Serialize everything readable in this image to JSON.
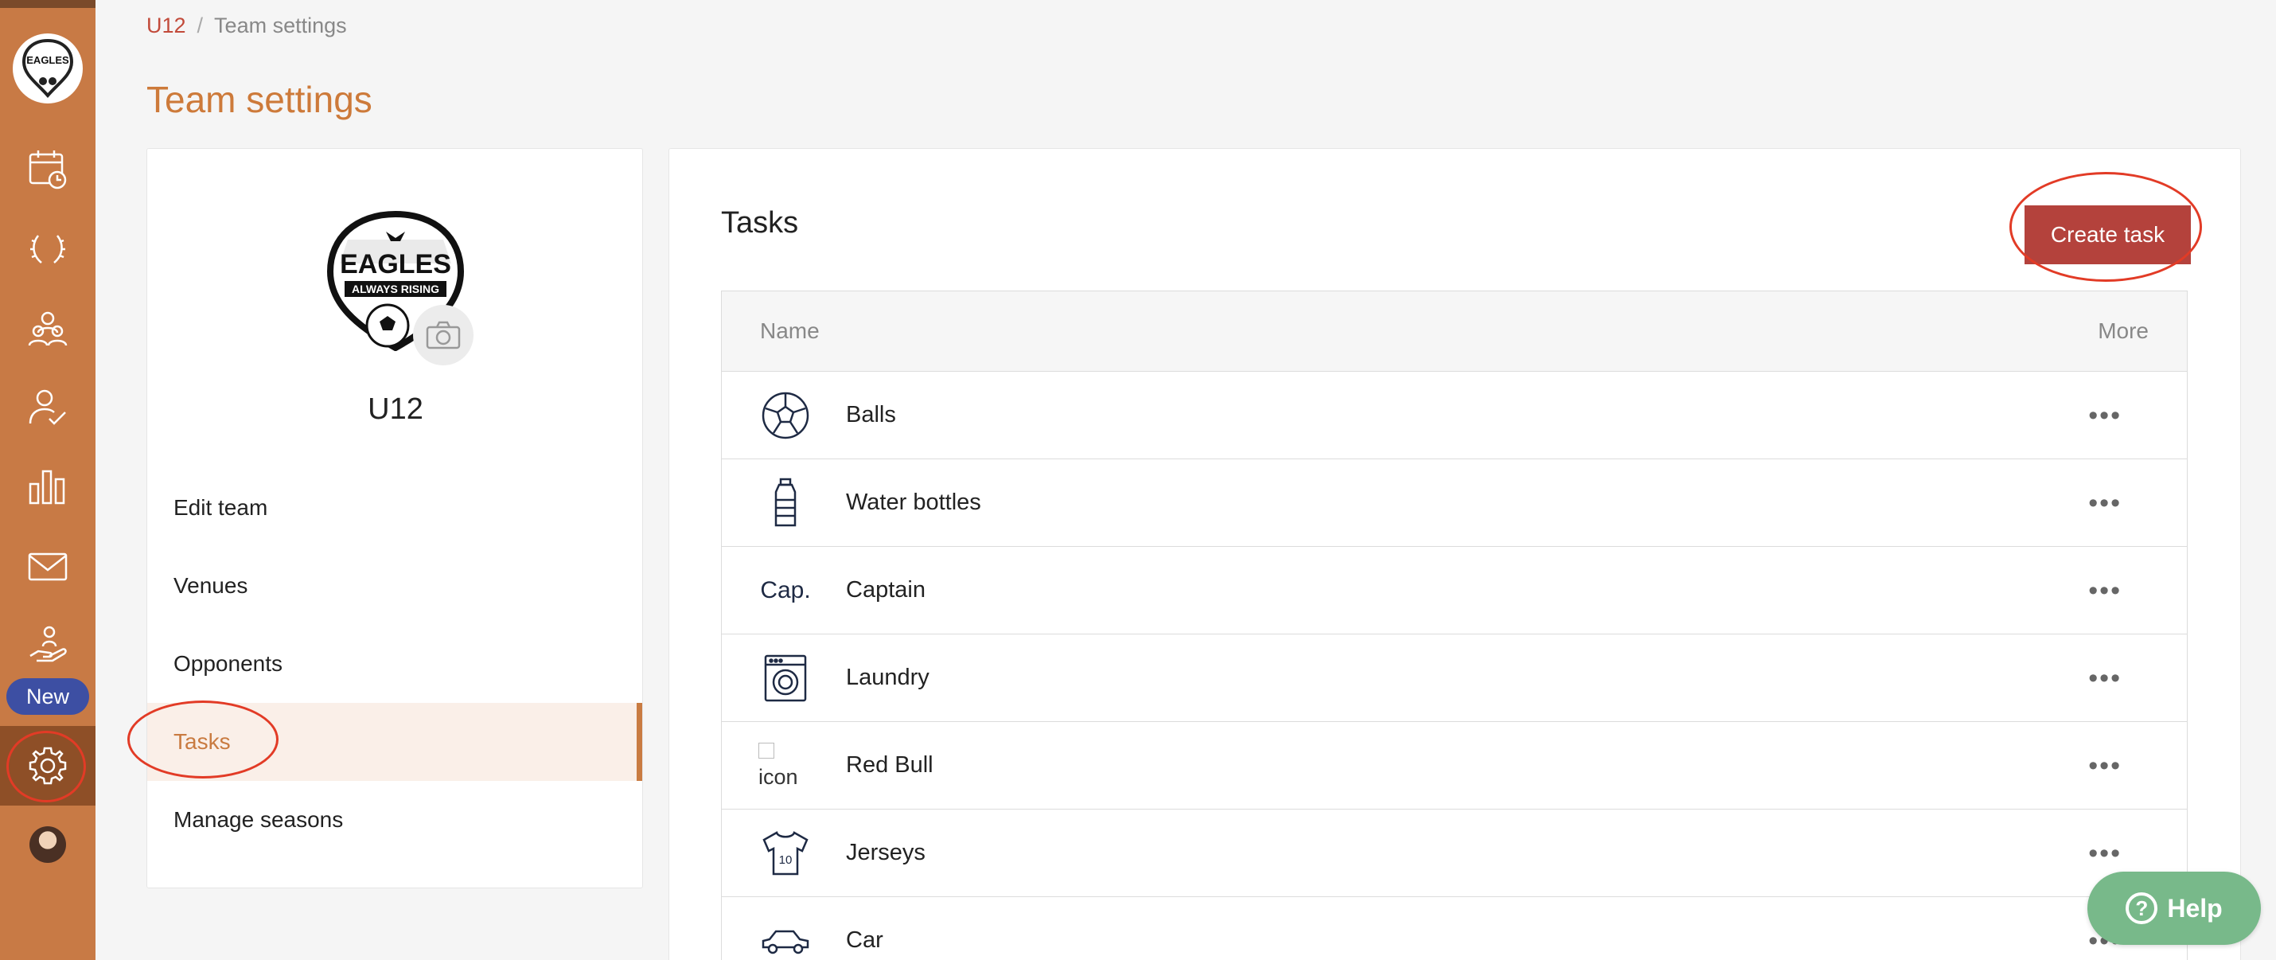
{
  "breadcrumb": {
    "team": "U12",
    "separator": "/",
    "current": "Team settings"
  },
  "page_title": "Team settings",
  "sidebar": {
    "logo_icon": "team-logo",
    "icons": [
      "calendar-clock-icon",
      "laurel-icon",
      "team-members-icon",
      "attendance-check-icon",
      "stats-chart-icon",
      "mail-icon",
      "volunteer-hand-icon",
      "gear-icon",
      "profile-avatar"
    ],
    "new_badge": "New"
  },
  "team_card": {
    "team_name": "U12",
    "badge_text": "EAGLES",
    "badge_subtext": "ALWAYS RISING",
    "menu": [
      {
        "label": "Edit team"
      },
      {
        "label": "Venues"
      },
      {
        "label": "Opponents"
      },
      {
        "label": "Tasks"
      },
      {
        "label": "Manage seasons"
      }
    ],
    "active_item": "Tasks"
  },
  "tasks_panel": {
    "title": "Tasks",
    "create_button": "Create task",
    "columns": {
      "name": "Name",
      "more": "More"
    },
    "rows": [
      {
        "name": "Balls",
        "icon": "ball-icon",
        "more": "•••"
      },
      {
        "name": "Water bottles",
        "icon": "water-bottle-icon",
        "more": "•••"
      },
      {
        "name": "Captain",
        "icon": "captain-text-icon",
        "icon_text": "Cap.",
        "more": "•••"
      },
      {
        "name": "Laundry",
        "icon": "washing-machine-icon",
        "more": "•••"
      },
      {
        "name": "Red Bull",
        "icon": "broken-image-icon",
        "icon_text": "icon",
        "more": "•••"
      },
      {
        "name": "Jerseys",
        "icon": "jersey-icon",
        "icon_text": "10",
        "more": "•••"
      },
      {
        "name": "Car",
        "icon": "car-icon",
        "more": "•••"
      }
    ]
  },
  "help_button": {
    "label": "Help"
  },
  "colors": {
    "rail": "#c87a45",
    "accent": "#cd7a3a",
    "primary_button": "#b4423c",
    "help": "#78b98a",
    "annotation": "#e23b26"
  }
}
